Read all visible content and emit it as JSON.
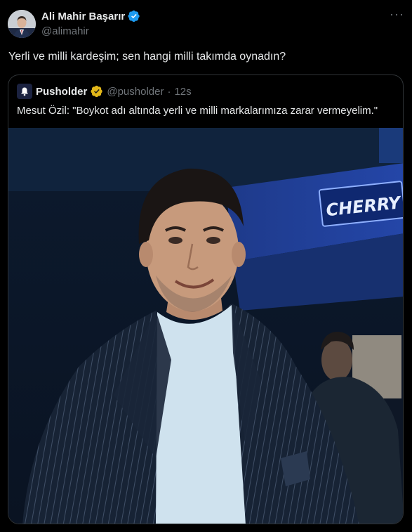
{
  "author": {
    "name": "Ali Mahir Başarır",
    "handle": "@alimahir",
    "verified": true
  },
  "tweet": {
    "text": "Yerli ve milli kardeşim; sen hangi milli takımda oynadın?"
  },
  "menu": {
    "more_icon": "more-dots-icon",
    "more_label": "···"
  },
  "quoted": {
    "name": "Pusholder",
    "handle": "@pusholder",
    "separator": "·",
    "time": "12s",
    "text": "Mesut Özil: \"Boykot adı altında yerli ve milli markalarımıza zarar vermeyelim.\"",
    "image_sign_text": "CHERRY"
  },
  "colors": {
    "background": "#000000",
    "text": "#e7e9ea",
    "secondary": "#71767b",
    "border": "#2f3336",
    "verified_blue": "#1d9bf0",
    "verified_gold": "#e2b719"
  }
}
